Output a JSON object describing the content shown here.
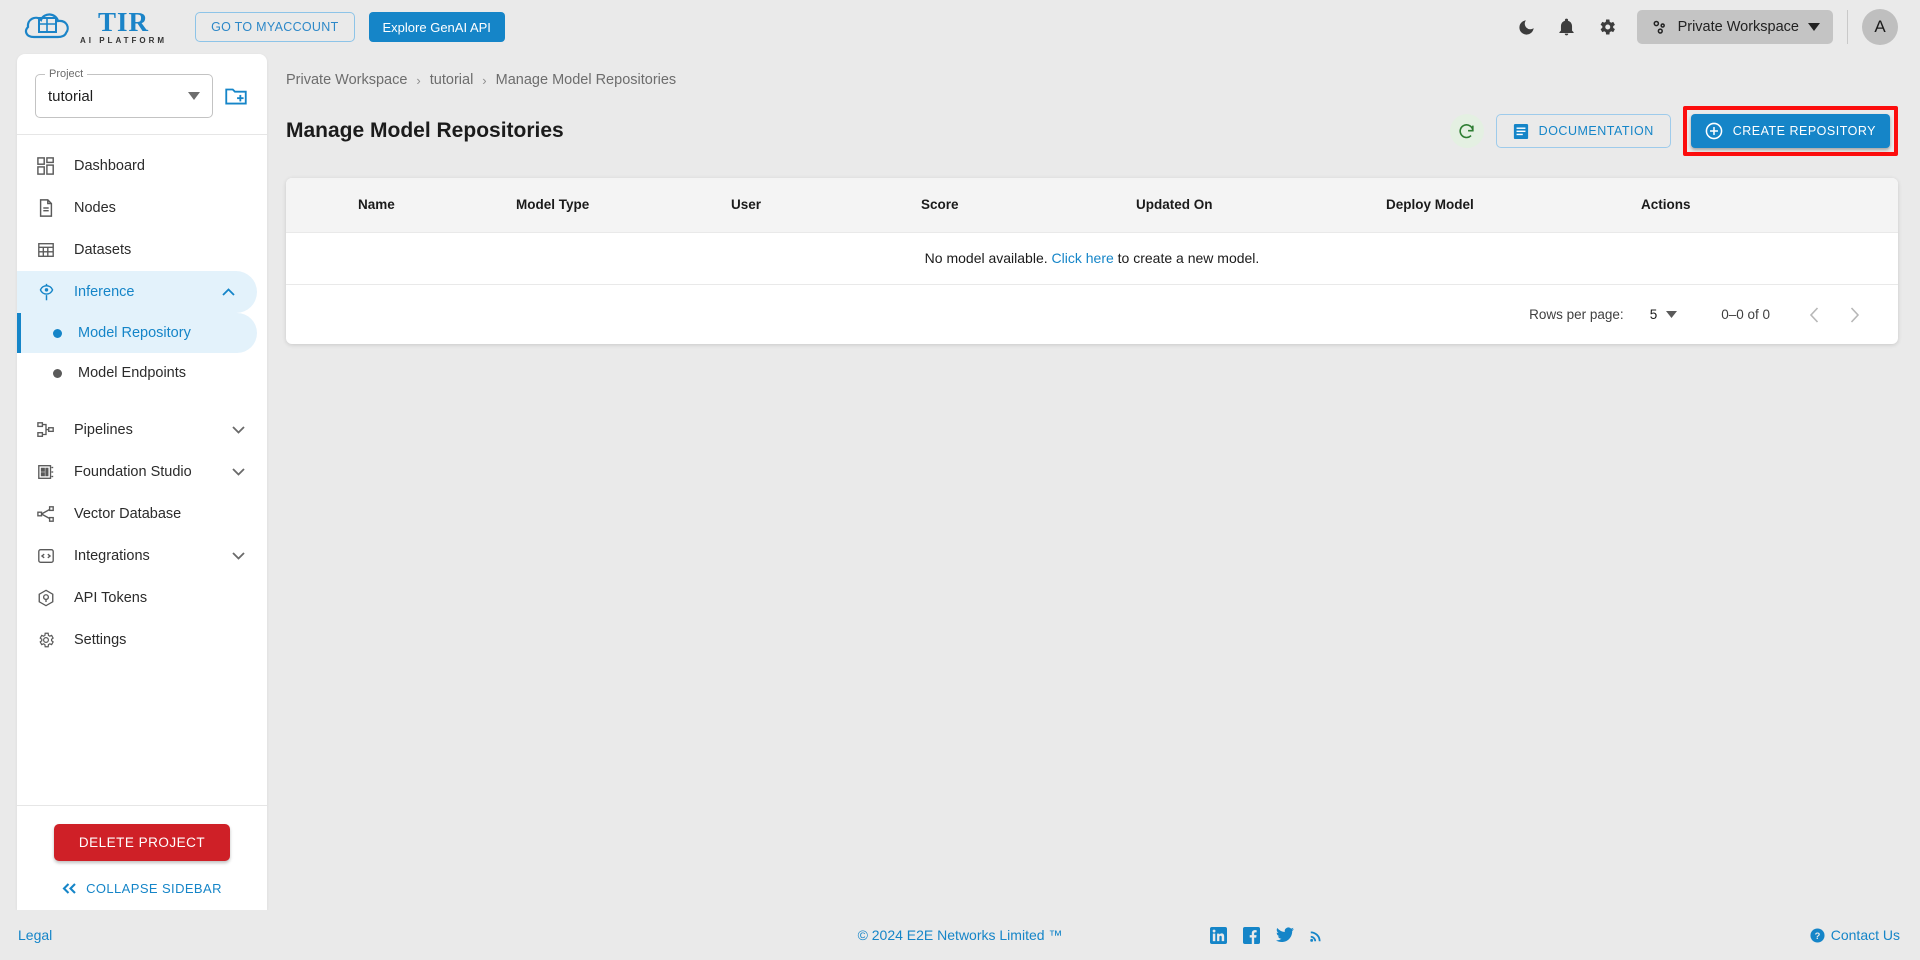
{
  "header": {
    "logo_title": "TIR",
    "logo_subtitle": "AI PLATFORM",
    "myaccount_label": "GO TO MYACCOUNT",
    "genai_label": "Explore GenAI API",
    "dark_mode_icon": "moon-icon",
    "notifications_icon": "bell-icon",
    "settings_icon": "gear-icon",
    "workspace_label": "Private Workspace",
    "workspace_icon": "workspace-nodes-icon",
    "avatar_initial": "A"
  },
  "sidebar": {
    "project_label": "Project",
    "project_value": "tutorial",
    "new_project_icon": "new-folder-icon",
    "items": [
      {
        "label": "Dashboard",
        "icon": "dashboard-icon",
        "expandable": false,
        "active": false
      },
      {
        "label": "Nodes",
        "icon": "nodes-document-icon",
        "expandable": false,
        "active": false
      },
      {
        "label": "Datasets",
        "icon": "datasets-grid-icon",
        "expandable": false,
        "active": false
      },
      {
        "label": "Inference",
        "icon": "inference-icon",
        "expandable": true,
        "active": true,
        "expanded": true
      },
      {
        "label": "Pipelines",
        "icon": "pipelines-icon",
        "expandable": true,
        "active": false
      },
      {
        "label": "Foundation Studio",
        "icon": "foundation-studio-icon",
        "expandable": true,
        "active": false
      },
      {
        "label": "Vector Database",
        "icon": "vector-database-icon",
        "expandable": false,
        "active": false
      },
      {
        "label": "Integrations",
        "icon": "integrations-code-icon",
        "expandable": true,
        "active": false
      },
      {
        "label": "API Tokens",
        "icon": "api-tokens-icon",
        "expandable": false,
        "active": false
      },
      {
        "label": "Settings",
        "icon": "settings-gear-icon",
        "expandable": false,
        "active": false
      }
    ],
    "sub_items": [
      {
        "label": "Model Repository",
        "active": true
      },
      {
        "label": "Model Endpoints",
        "active": false
      }
    ],
    "delete_project_label": "DELETE PROJECT",
    "collapse_label": "COLLAPSE SIDEBAR",
    "collapse_icon": "double-chevron-left-icon"
  },
  "main": {
    "breadcrumb": [
      "Private Workspace",
      "tutorial",
      "Manage Model Repositories"
    ],
    "breadcrumb_separator": "›",
    "page_title": "Manage Model Repositories",
    "refresh_icon": "refresh-icon",
    "documentation_label": "DOCUMENTATION",
    "documentation_icon": "document-icon",
    "create_label": "CREATE REPOSITORY",
    "create_icon": "plus-circle-icon",
    "table": {
      "columns": [
        "Name",
        "Model Type",
        "User",
        "Score",
        "Updated On",
        "Deploy Model",
        "Actions"
      ],
      "rows": [],
      "empty_text_before": "No model available.",
      "empty_link": "Click here",
      "empty_text_after": "to create a new model."
    },
    "pagination": {
      "rows_per_page_label": "Rows per page:",
      "rows_per_page_value": "5",
      "range_label": "0–0 of 0",
      "prev_icon": "chevron-left-icon",
      "next_icon": "chevron-right-icon"
    }
  },
  "footer": {
    "legal": "Legal",
    "copyright": "© 2024 E2E Networks Limited ™",
    "social": [
      "linkedin-icon",
      "facebook-icon",
      "twitter-icon",
      "rss-icon"
    ],
    "contact_label": "Contact Us",
    "contact_icon": "help-circle-icon"
  },
  "colors": {
    "brand_blue": "#1585c8",
    "highlight_red": "#fc0d0d",
    "danger_red": "#cf2027",
    "refresh_green": "#2e7d32",
    "active_bg": "#e3f2fb"
  }
}
